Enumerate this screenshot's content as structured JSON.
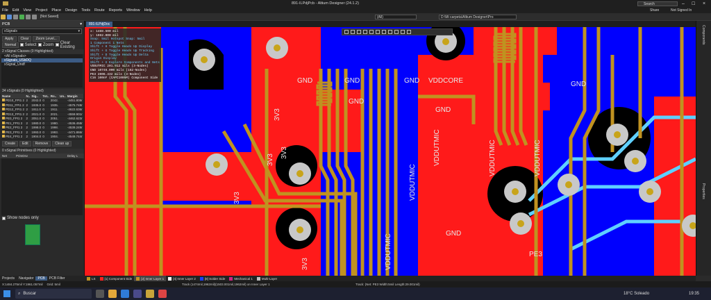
{
  "window": {
    "title": "891-ILPdjPcb - Altium Designer (24.1.2)",
    "search_placeholder": "Search",
    "share_label": "Share",
    "account_label": "Not Signed In"
  },
  "menu": [
    "File",
    "Edit",
    "View",
    "Project",
    "Place",
    "Design",
    "Tools",
    "Route",
    "Reports",
    "Window",
    "Help"
  ],
  "toolbar": {
    "saved_status": "[Not Saved]",
    "filter_value": "(All)",
    "path_value": "D:\\Mi carpeta\\Altium Designer\\Pro"
  },
  "left_panel": {
    "title": "PCB",
    "mode": "xSignals",
    "apply_label": "Apply",
    "clear_label": "Clear",
    "zoom_level_label": "Zoom Level...",
    "view_mode": "Normal",
    "select_label": "Select",
    "zoom_label": "Zoom",
    "clear_existing_label": "Clear Existing",
    "classes_header": "2 xSignal Classes (0 Highlighted)",
    "classes": [
      "<All xSignals>",
      "xSignals_USbDQ",
      "xSignal_Undf"
    ],
    "signals_header": "34 xSignals (0 Highlighted)",
    "columns": [
      "Name",
      "N..",
      "Sig..",
      "Tot..",
      "Ro..",
      "Un..",
      "Margin"
    ],
    "rows": [
      [
        "PD10_FPI1 2",
        "2",
        "2042.0",
        "0",
        "2042.",
        "",
        "-4451.808r"
      ],
      [
        "PD11_FPI1 2",
        "2",
        "1935.0",
        "0",
        "1935.",
        "",
        "-4575.748r"
      ],
      [
        "PD12_FPI1 2",
        "2",
        "1911.0",
        "0",
        "1911.",
        "",
        "-4622.636r"
      ],
      [
        "PD13_FPI1 2",
        "2",
        "2021.0",
        "0",
        "2021.",
        "",
        "-4559.901r"
      ],
      [
        "PE0_FPI1 2",
        "2",
        "2051.0",
        "0",
        "2051.",
        "",
        "-4462.623r"
      ],
      [
        "PE1_FPI1 2",
        "2",
        "1980.0",
        "0",
        "1980.",
        "",
        "-4536.458r"
      ],
      [
        "PE2_FPI1 2",
        "2",
        "1998.0",
        "0",
        "1998.",
        "",
        "-4539.249r"
      ],
      [
        "PE3_FPI1 2",
        "2",
        "1993.0",
        "0",
        "1993.",
        "",
        "-4471.866r"
      ],
      [
        "PE4_FPI1 2",
        "2",
        "1904.0",
        "0",
        "1904.",
        "",
        "-4549.744r"
      ]
    ],
    "bottom_buttons": [
      "Create",
      "Edit",
      "Remove",
      "Clean up"
    ],
    "primitives_header": "0 xSignal Primitives (0 Highlighted)",
    "primitives_columns": [
      "Net",
      "PrimDsv",
      "Delay L"
    ],
    "show_nodes_label": "Show nodes only"
  },
  "document": {
    "tab_label": "891-ILPdjDoc"
  },
  "hud": {
    "x": "x: 1488.500 mil",
    "y": "y: 1962.000 mil",
    "snap": "Snap: 5mil Hotspot Snap: 5mil",
    "lines": [
      "1 Component 1 Nets",
      "Shift + H  Toggle Heads Up Display",
      "Shift + G  Toggle Heads Up Tracking",
      "Shift + D  Toggle Heads Up Delta Origin Display",
      "Shift + X  Explore Components and Nets",
      "VDDUTMIC   201.912 mils   (3-Nodes)",
      "GND        10746.000 mils  (162-Nodes)",
      "PE3        2006.432 mils   (3-Nodes)",
      "C16  100nF  (CAPC1005M)  Component Side"
    ]
  },
  "pcb_labels": [
    "GND",
    "3V3",
    "GND",
    "GND",
    "GND",
    "VDDCORE",
    "VDDUTMIC",
    "3V3",
    "3V3",
    "GND",
    "VDDUTMIC",
    "VDDUTMIC",
    "GND",
    "GND",
    "VDDUTMIC",
    "PE3",
    "3V3",
    "3V3",
    "VDDUTMIC"
  ],
  "right_rail": [
    "Components",
    "Properties"
  ],
  "layers": [
    {
      "name": "LS",
      "color": "#c09220"
    },
    {
      "name": "[1] Component Side",
      "color": "#ff2020"
    },
    {
      "name": "[2] Inner Layer 1",
      "color": "#c09220"
    },
    {
      "name": "[4] Inner Layer 2",
      "color": "#ffffff"
    },
    {
      "name": "[8] Solder Side",
      "color": "#1a3cff"
    },
    {
      "name": "Mechanical 1",
      "color": "#d02080"
    },
    {
      "name": "Multi-Layer",
      "color": "#c0c0c0"
    }
  ],
  "panel_tabs": [
    "Projects",
    "Navigator",
    "PCB",
    "PCB Filter"
  ],
  "status": {
    "coords": "X:1484.275mil Y:1961.057mil",
    "grid": "Grid: 5mil",
    "track": "Track (1474mil,1962mil)(1503.001mil,1962mil) on Inner Layer 1",
    "net_info": "Track: (Net: PE3 Width:5mil Length:29.001mil)"
  },
  "taskbar": {
    "search_label": "Buscar",
    "weather": "18°C  Soleado",
    "time": "19:35"
  }
}
